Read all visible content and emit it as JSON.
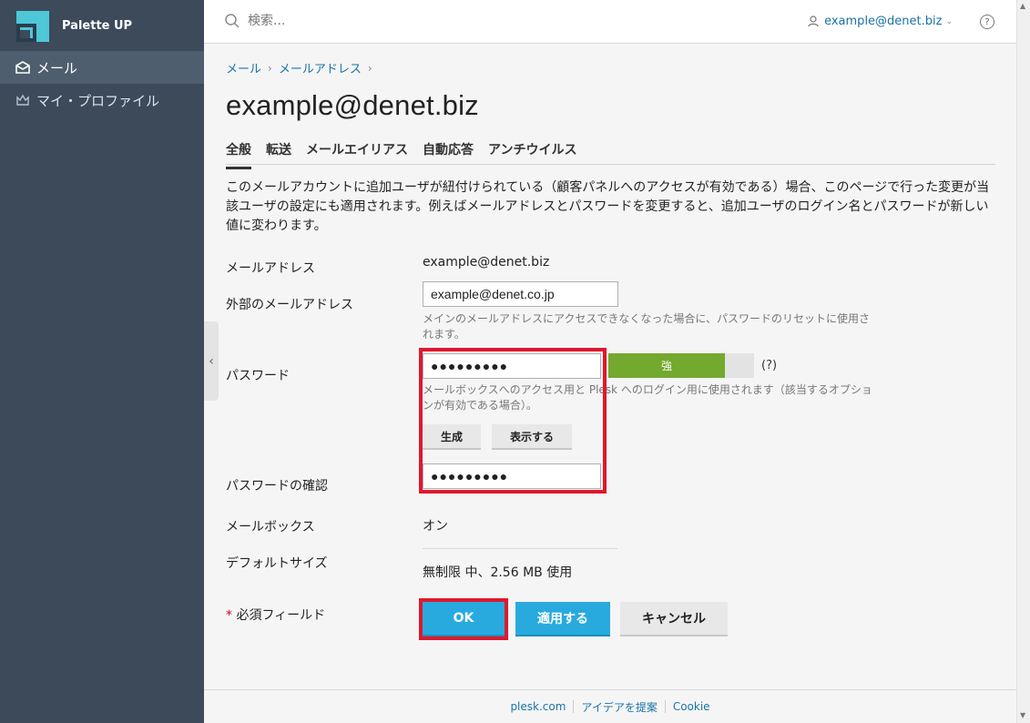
{
  "sidebar": {
    "brand": "Palette UP",
    "items": [
      {
        "label": "メール",
        "icon": "envelope-icon",
        "active": true
      },
      {
        "label": "マイ・プロファイル",
        "icon": "crown-icon",
        "active": false
      }
    ]
  },
  "header": {
    "search_placeholder": "検索...",
    "user_email": "example@denet.biz",
    "help_label": "?"
  },
  "breadcrumb": [
    "メール",
    "メールアドレス"
  ],
  "page_title": "example@denet.biz",
  "tabs": [
    "全般",
    "転送",
    "メールエイリアス",
    "自動応答",
    "アンチウイルス"
  ],
  "intro_text": "このメールアカウントに追加ユーザが紐付けられている（顧客パネルへのアクセスが有効である）場合、このページで行った変更が当該ユーザの設定にも適用されます。例えばメールアドレスとパスワードを変更すると、追加ユーザのログイン名とパスワードが新しい値に変わります。",
  "form": {
    "email_label": "メールアドレス",
    "email_value": "example@denet.biz",
    "external_label": "外部のメールアドレス",
    "external_value": "example@denet.co.jp",
    "external_hint": "メインのメールアドレスにアクセスできなくなった場合に、パスワードのリセットに使用されます。",
    "password_label": "パスワード",
    "password_value": "●●●●●●●●●",
    "strength_label": "強",
    "strength_help": "(?)",
    "password_hint": "メールボックスへのアクセス用と Plesk へのログイン用に使用されます（該当するオプションが有効である場合）。",
    "generate_label": "生成",
    "show_label": "表示する",
    "confirm_label": "パスワードの確認",
    "confirm_value": "●●●●●●●●●",
    "mailbox_label": "メールボックス",
    "mailbox_value": "オン",
    "default_size_label": "デフォルトサイズ",
    "default_size_value": "無制限 中、2.56 MB 使用",
    "required_star": "*",
    "required_label": "必須フィールド"
  },
  "buttons": {
    "ok": "OK",
    "apply": "適用する",
    "cancel": "キャンセル"
  },
  "footer": [
    "plesk.com",
    "アイデアを提案",
    "Cookie"
  ],
  "colors": {
    "sidebar": "#3c4a5a",
    "accent": "#28aadf",
    "link": "#1a73a8",
    "highlight": "#e0182d",
    "strength": "#73a92e"
  }
}
